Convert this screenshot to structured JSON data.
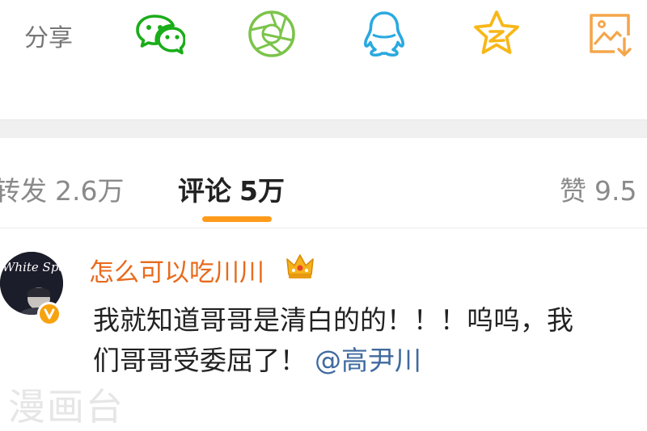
{
  "share": {
    "label": "分享",
    "icons": [
      "wechat-icon",
      "moments-icon",
      "qq-icon",
      "qzone-icon",
      "save-image-icon"
    ],
    "colors": {
      "wechat": "#1aad19",
      "moments": "#7bc44a",
      "qq": "#2aa9e0",
      "qzone": "#f8b718",
      "save": "#f4a64a"
    }
  },
  "tabs": {
    "repost": {
      "label": "转发",
      "count": "2.6万"
    },
    "comments": {
      "label": "评论",
      "count": "5万"
    },
    "likes": {
      "label": "赞",
      "count": "9.5"
    },
    "accent": "#ff9b1b"
  },
  "comment": {
    "username": "怎么可以吃川川",
    "avatar_text": "White Space",
    "line1": "我就知道哥哥是清白的的！！！呜呜，我",
    "line2": "们哥哥受委屈了！",
    "mention": "@高尹川",
    "colors": {
      "username": "#e86a1c",
      "mention": "#3f6a9e"
    }
  },
  "watermark": "漫画台"
}
